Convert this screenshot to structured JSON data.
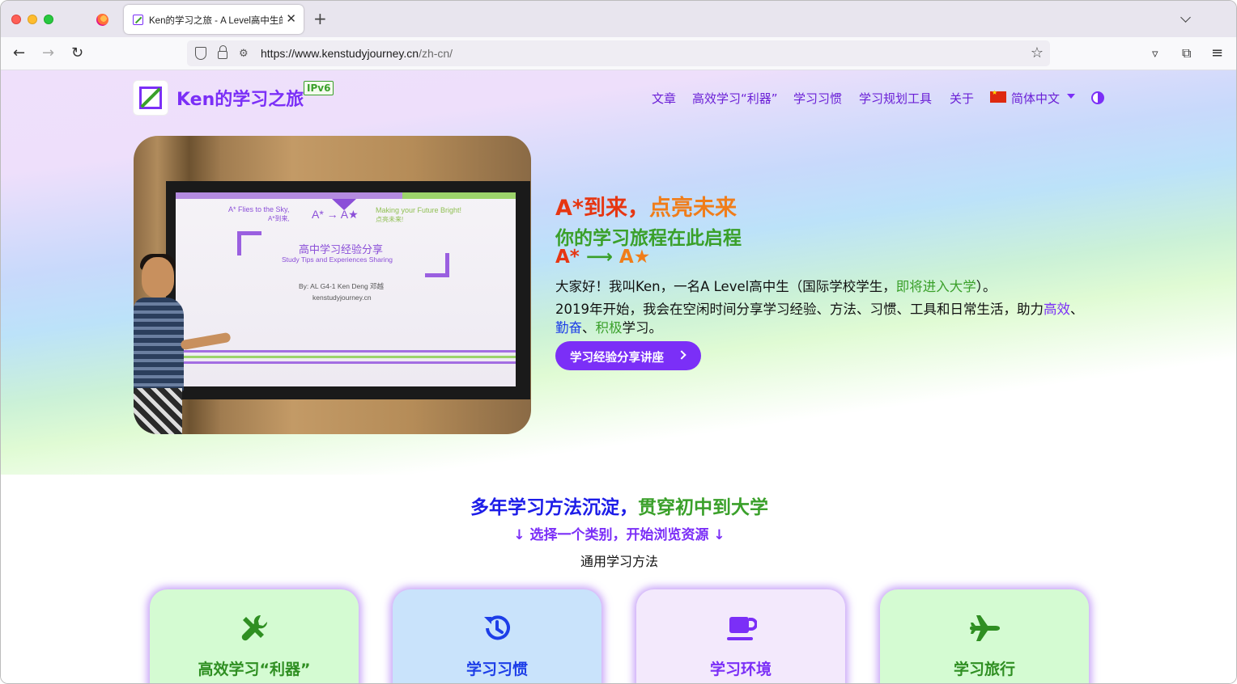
{
  "browser": {
    "tab_title": "Ken的学习之旅 - A Level高中生的",
    "url_host": "https://www.kenstudyjourney.cn",
    "url_path": "/zh-cn/"
  },
  "site": {
    "name": "Ken的学习之旅",
    "badge": "IPv6",
    "menu": [
      "文章",
      "高效学习“利器”",
      "学习习惯",
      "学习规划工具",
      "关于"
    ],
    "language": "简体中文"
  },
  "hero": {
    "slogan_a": "A*到来，",
    "slogan_b": "点亮未来",
    "sub": "你的学习旅程在此启程",
    "arrow_a": "A*",
    "arrow_mid": " ⟶ ",
    "arrow_b": "A★",
    "p1_a": "大家好！我叫Ken，一名A Level高中生（国际学校学生，",
    "p1_b": "即将进入大学",
    "p1_c": "）。",
    "p2_a": "2019年开始，我会在空闲时间分享学习经验、方法、习惯、工具和日常生活，助力",
    "p2_b": "高效",
    "p2_c": "、",
    "p2_d": "勤奋",
    "p2_e": "、",
    "p2_f": "积极",
    "p2_g": "学习。",
    "cta": "学习经验分享讲座",
    "photo": {
      "line1": "A* Flies to the Sky,",
      "line2": "A*到来,",
      "line3": "A* → A★",
      "line4": "Making your Future Bright!",
      "line5": "点亮未来!",
      "title": "高中学习经验分享",
      "subtitle": "Study Tips and Experiences Sharing",
      "by": "By: AL G4-1 Ken Deng 邓越",
      "site": "kenstudyjourney.cn"
    }
  },
  "section": {
    "title_a": "多年学习方法沉淀，",
    "title_b": "贯穿初中到大学",
    "sub": "↓ 选择一个类别，开始浏览资源 ↓",
    "category": "通用学习方法",
    "cards": [
      {
        "title": "高效学习“利器”",
        "icon": "tools-icon",
        "bg": "#d4fbd2",
        "color": "#2f8f22"
      },
      {
        "title": "学习习惯",
        "icon": "history-icon",
        "bg": "#c9e3fb",
        "color": "#1d3ee8"
      },
      {
        "title": "学习环境",
        "icon": "coffee-cup-icon",
        "bg": "#f3e9fc",
        "color": "#7b2ff7"
      },
      {
        "title": "学习旅行",
        "icon": "airplane-icon",
        "bg": "#d4fbd2",
        "color": "#2f8f22"
      }
    ]
  }
}
